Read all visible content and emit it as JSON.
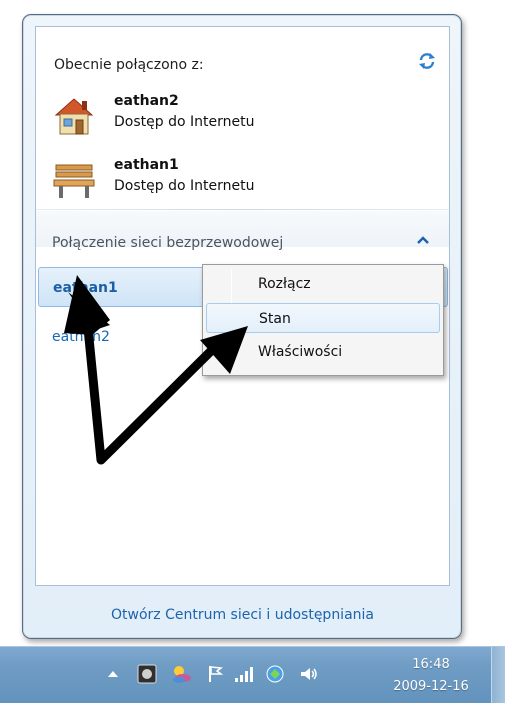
{
  "flyout": {
    "connected_title": "Obecnie połączono z:",
    "connected_networks": [
      {
        "name": "eathan2",
        "status": "Dostęp do Internetu",
        "icon": "house-network-icon"
      },
      {
        "name": "eathan1",
        "status": "Dostęp do Internetu",
        "icon": "bench-public-network-icon"
      }
    ],
    "refresh_icon": "refresh-icon",
    "section_title": "Połączenie sieci bezprzewodowej",
    "wireless_networks": [
      {
        "name": "eathan1",
        "selected": true
      },
      {
        "name": "eathan2",
        "selected": false
      }
    ],
    "footer_link": "Otwórz Centrum sieci i udostępniania"
  },
  "context_menu": {
    "items": [
      {
        "label": "Rozłącz"
      },
      {
        "label": "Stan"
      },
      {
        "label": "Właściwości"
      }
    ]
  },
  "taskbar": {
    "tray_icons": [
      "show-hidden-icons-arrow",
      "security-icon",
      "weather-icon",
      "flag-icon",
      "signal-icon",
      "network-icon",
      "volume-icon"
    ],
    "time": "16:48",
    "date": "2009-12-16"
  },
  "colors": {
    "accent": "#1669b3",
    "link": "#1d63ad",
    "taskbar": "#6f9cc4"
  }
}
